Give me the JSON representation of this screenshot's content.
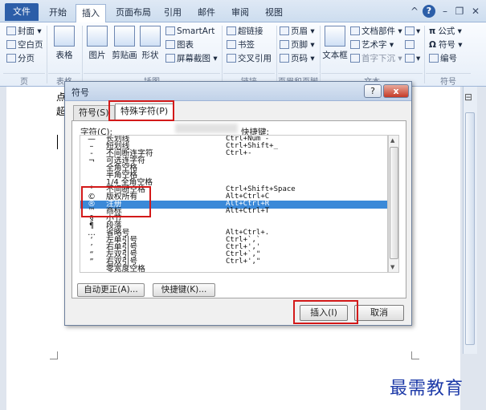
{
  "tabs": {
    "file": "文件",
    "items": [
      "开始",
      "插入",
      "页面布局",
      "引用",
      "邮件",
      "审阅",
      "视图"
    ],
    "active": "插入"
  },
  "ribbon": {
    "pages": {
      "cover": "封面",
      "blank": "空白页",
      "break": "分页",
      "group": "页"
    },
    "table": {
      "label": "表格",
      "group": "表格"
    },
    "illustrations": {
      "picture": "图片",
      "clipart": "剪贴画",
      "shapes": "形状",
      "smartart": "SmartArt",
      "chart": "图表",
      "screenshot": "屏幕截图",
      "group": "插图"
    },
    "links": {
      "hyperlink": "超链接",
      "bookmark": "书签",
      "crossref": "交叉引用",
      "group": "链接"
    },
    "headerfooter": {
      "header": "页眉",
      "footer": "页脚",
      "pagenum": "页码",
      "group": "页眉和页脚"
    },
    "text": {
      "textbox": "文本框",
      "docparts": "文档部件",
      "wordart": "艺术字",
      "dropcap": "首字下沉",
      "group": "文本"
    },
    "symbols": {
      "equation": "公式",
      "symbol": "符号",
      "numbering": "编号",
      "group": "符号"
    }
  },
  "document": {
    "line1": "点",
    "line2": "超"
  },
  "dialog": {
    "title": "符号",
    "help": "?",
    "close": "x",
    "tab_symbols": "符号(S)",
    "tab_special": "特殊字符(P)",
    "col_char": "字符(C):",
    "col_shortcut": "快捷键:",
    "rows": [
      {
        "sym": "—",
        "name": "长划线",
        "key": "Ctrl+Num -"
      },
      {
        "sym": "–",
        "name": "短划线",
        "key": "Ctrl+Shift+_"
      },
      {
        "sym": "-",
        "name": "不间断连字符",
        "key": "Ctrl+-"
      },
      {
        "sym": "¬",
        "name": "可选连字符",
        "key": ""
      },
      {
        "sym": "",
        "name": "全角空格",
        "key": ""
      },
      {
        "sym": "",
        "name": "半角空格",
        "key": ""
      },
      {
        "sym": "",
        "name": "1/4 全角空格",
        "key": ""
      },
      {
        "sym": "°",
        "name": "不间断空格",
        "key": "Ctrl+Shift+Space"
      },
      {
        "sym": "©",
        "name": "版权所有",
        "key": "Alt+Ctrl+C"
      },
      {
        "sym": "®",
        "name": "注册",
        "key": "Alt+Ctrl+R"
      },
      {
        "sym": "™",
        "name": "商标",
        "key": "Alt+Ctrl+T"
      },
      {
        "sym": "§",
        "name": "小节",
        "key": ""
      },
      {
        "sym": "¶",
        "name": "段落",
        "key": ""
      },
      {
        "sym": "…",
        "name": "省略号",
        "key": "Alt+Ctrl+."
      },
      {
        "sym": "‘",
        "name": "左单引号",
        "key": "Ctrl+`,`"
      },
      {
        "sym": "’",
        "name": "右单引号",
        "key": "Ctrl+','"
      },
      {
        "sym": "“",
        "name": "左双引号",
        "key": "Ctrl+`,\""
      },
      {
        "sym": "”",
        "name": "右双引号",
        "key": "Ctrl+',\""
      },
      {
        "sym": "",
        "name": "零宽度空格",
        "key": ""
      }
    ],
    "selected_row": 9,
    "autocorrect": "自动更正(A)...",
    "shortcut_key": "快捷键(K)...",
    "insert": "插入(I)",
    "cancel": "取消"
  },
  "watermark": "最需教育",
  "colors": {
    "selection": "#3b89d8",
    "highlight": "#d31919",
    "file_tab": "#2c5ea8"
  }
}
